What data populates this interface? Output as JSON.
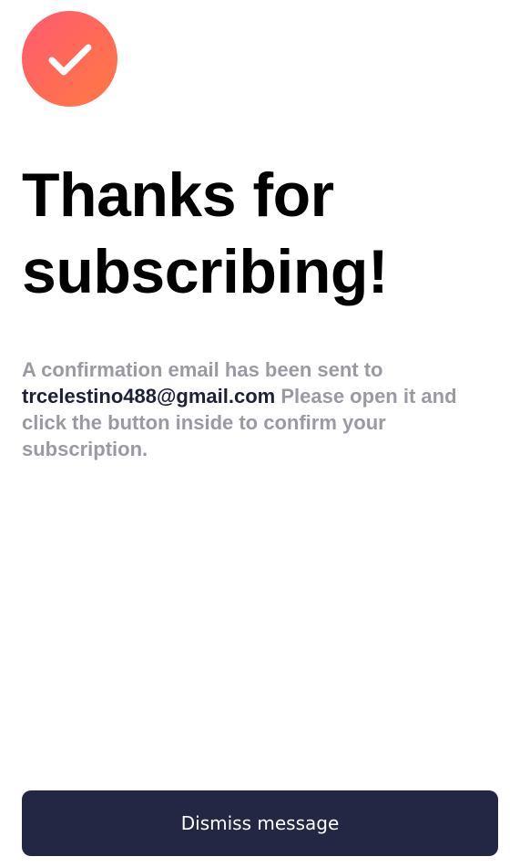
{
  "header": {
    "icon": "checkmark-icon",
    "accent_gradient": [
      "#ff5a72",
      "#ff7a45"
    ],
    "title": "Thanks for subscribing!"
  },
  "message": {
    "before_email": "A confirmation email has been sent to ",
    "email": "trcelestino488@gmail.com",
    "after_email": " Please open it and click the button inside to confirm your subscription."
  },
  "footer": {
    "dismiss_label": "Dismiss message",
    "button_color": "#232744"
  }
}
